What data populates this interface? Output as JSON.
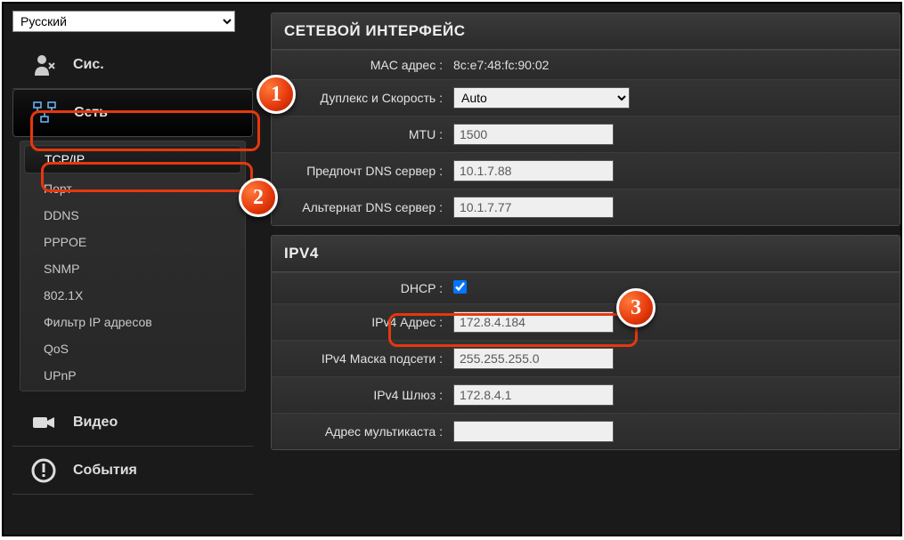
{
  "language": "Русский",
  "sidebar": {
    "system": "Сис.",
    "network": "Сеть",
    "video": "Видео",
    "events": "События",
    "submenu": [
      "TCP/IP",
      "Порт",
      "DDNS",
      "PPPOE",
      "SNMP",
      "802.1X",
      "Фильтр IP адресов",
      "QoS",
      "UPnP"
    ]
  },
  "panels": {
    "net_iface": {
      "title": "СЕТЕВОЙ ИНТЕРФЕЙС",
      "mac_label": "MAC адрес :",
      "mac_value": "8c:e7:48:fc:90:02",
      "duplex_label": "Дуплекс и Скорость :",
      "duplex_value": "Auto",
      "mtu_label": "MTU :",
      "mtu_value": "1500",
      "dns1_label": "Предпочт DNS сервер :",
      "dns1_value": "10.1.7.88",
      "dns2_label": "Альтернат DNS сервер :",
      "dns2_value": "10.1.7.77"
    },
    "ipv4": {
      "title": "IPV4",
      "dhcp_label": "DHCP :",
      "dhcp_checked": true,
      "addr_label": "IPv4 Адрес :",
      "addr_value": "172.8.4.184",
      "mask_label": "IPv4 Маска подсети :",
      "mask_value": "255.255.255.0",
      "gw_label": "IPv4 Шлюз :",
      "gw_value": "172.8.4.1",
      "mcast_label": "Адрес мультикаста :",
      "mcast_value": ""
    }
  },
  "callouts": [
    "1",
    "2",
    "3"
  ]
}
